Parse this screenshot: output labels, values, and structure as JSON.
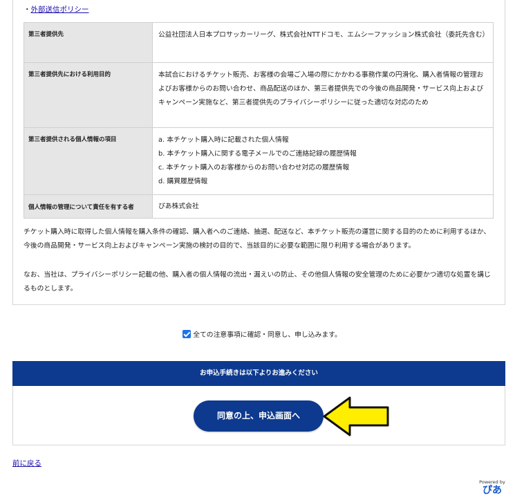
{
  "policy_link": {
    "prefix": "・",
    "label": "外部送信ポリシー"
  },
  "table": {
    "rows": [
      {
        "header": "第三者提供先",
        "lines": [
          "公益社団法人日本プロサッカーリーグ、株式会社NTTドコモ、エムシーファッション株式会社（委託先含む）"
        ]
      },
      {
        "header": "第三者提供先における利用目的",
        "lines": [
          "本試合におけるチケット販売、お客様の会場ご入場の際にかかわる事務作業の円滑化、購入者情報の管理およびお客様からのお問い合わせ、商品配送のほか、第三者提供先での今後の商品開発・サービス向上およびキャンペーン実施など、第三者提供先のプライバシーポリシーに従った適切な対応のため"
        ]
      },
      {
        "header": "第三者提供される個人情報の項目",
        "lines": [
          "a. 本チケット購入時に記載された個人情報",
          "b. 本チケット購入に関する電子メールでのご連絡記録の履歴情報",
          "c. 本チケット購入のお客様からのお問い合わせ対応の履歴情報",
          "d. 購買履歴情報"
        ]
      },
      {
        "header": "個人情報の管理について責任を有する者",
        "lines": [
          "ぴあ株式会社"
        ]
      }
    ]
  },
  "paragraphs": [
    "チケット購入時に取得した個人情報を購入条件の確認、購入者へのご連絡、抽選、配送など、本チケット販売の運営に関する目的のために利用するほか、今後の商品開発・サービス向上およびキャンペーン実施の検討の目的で、当該目的に必要な範囲に限り利用する場合があります。",
    "なお、当社は、プライバシーポリシー記載の他、購入者の個人情報の流出・漏えいの防止、その他個人情報の安全管理のために必要かつ適切な処置を講じるものとします。"
  ],
  "agree_checkbox": {
    "checked": true,
    "label": "全ての注意事項に確認・同意し、申し込みます。"
  },
  "apply_banner": "お申込手続きは以下よりお進みください",
  "apply_button": "同意の上、申込画面へ",
  "back_link": "前に戻る",
  "footer": {
    "powered_by": "Powered by",
    "logo": "ぴあ"
  },
  "colors": {
    "brand_blue": "#0d3a8f",
    "arrow_yellow": "#ffee00",
    "link": "#1a0dab"
  },
  "icons": {
    "arrow": "left-arrow-icon",
    "checkbox": "checkbox-checked-icon"
  }
}
